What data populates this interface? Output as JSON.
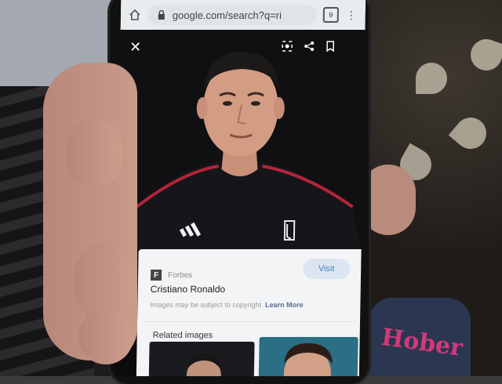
{
  "browser": {
    "url": "google.com/search?q=ri",
    "tab_count": "9"
  },
  "viewer": {
    "close_label": "✕"
  },
  "result": {
    "source_initial": "F",
    "source_name": "Forbes",
    "visit_label": "Visit",
    "title": "Cristiano Ronaldo",
    "copyright_text": "Images may be subject to copyright.",
    "learn_more": "Learn More",
    "related_heading": "Related images"
  },
  "colors": {
    "url_bar": "#e7ecef",
    "card": "#f2f4f6",
    "visit_text": "#4a7cc9",
    "jersey_stripe": "#b3243a"
  }
}
